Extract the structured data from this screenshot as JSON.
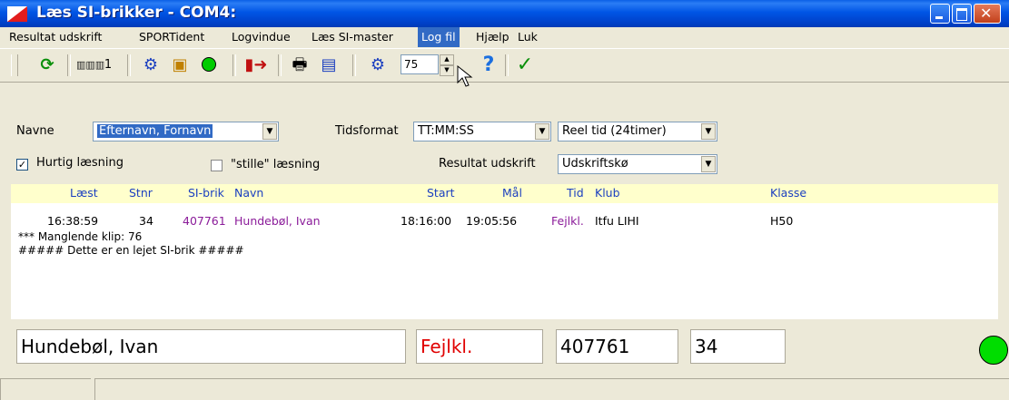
{
  "window": {
    "title": "Læs SI-brikker - COM4:"
  },
  "menu": [
    {
      "label": "Resultat udskrift"
    },
    {
      "label": "SPORTident"
    },
    {
      "label": "Logvindue"
    },
    {
      "label": "Læs SI-master"
    },
    {
      "label": "Log fil"
    },
    {
      "label": "Hjælp"
    },
    {
      "label": "Luk"
    }
  ],
  "toolbar": {
    "count_label": "1",
    "spin_value": "75"
  },
  "form": {
    "names_label": "Navne",
    "names_value": "Efternavn, Fornavn",
    "time_format_label": "Tidsformat",
    "time_format_value": "TT:MM:SS",
    "time_mode_value": "Reel tid (24timer)",
    "fast_read_label": "Hurtig læsning",
    "quiet_read_label": "\"stille\" læsning",
    "print_label": "Resultat udskrift",
    "print_value": "Udskriftskø"
  },
  "table": {
    "headers": [
      "Læst",
      "Stnr",
      "SI-brik",
      "Navn",
      "Start",
      "Mål",
      "Tid",
      "Klub",
      "Klasse"
    ],
    "row": {
      "read": "16:38:59",
      "stnr": "34",
      "si": "407761",
      "name": "Hundebøl, Ivan",
      "start": "18:16:00",
      "finish": "19:05:56",
      "time": "Fejlkl.",
      "club": "Itfu LIHI",
      "class": "H50"
    },
    "notes": [
      "*** Manglende klip: 76",
      "##### Dette er en lejet SI-brik #####"
    ]
  },
  "summary": {
    "name": "Hundebøl, Ivan",
    "status": "Fejlkl.",
    "si": "407761",
    "stnr": "34"
  },
  "colors": {
    "status_error": "#e00000",
    "indicator": "#00dd00",
    "header_bg": "#ffffcc",
    "header_text": "#1b3fc0"
  }
}
